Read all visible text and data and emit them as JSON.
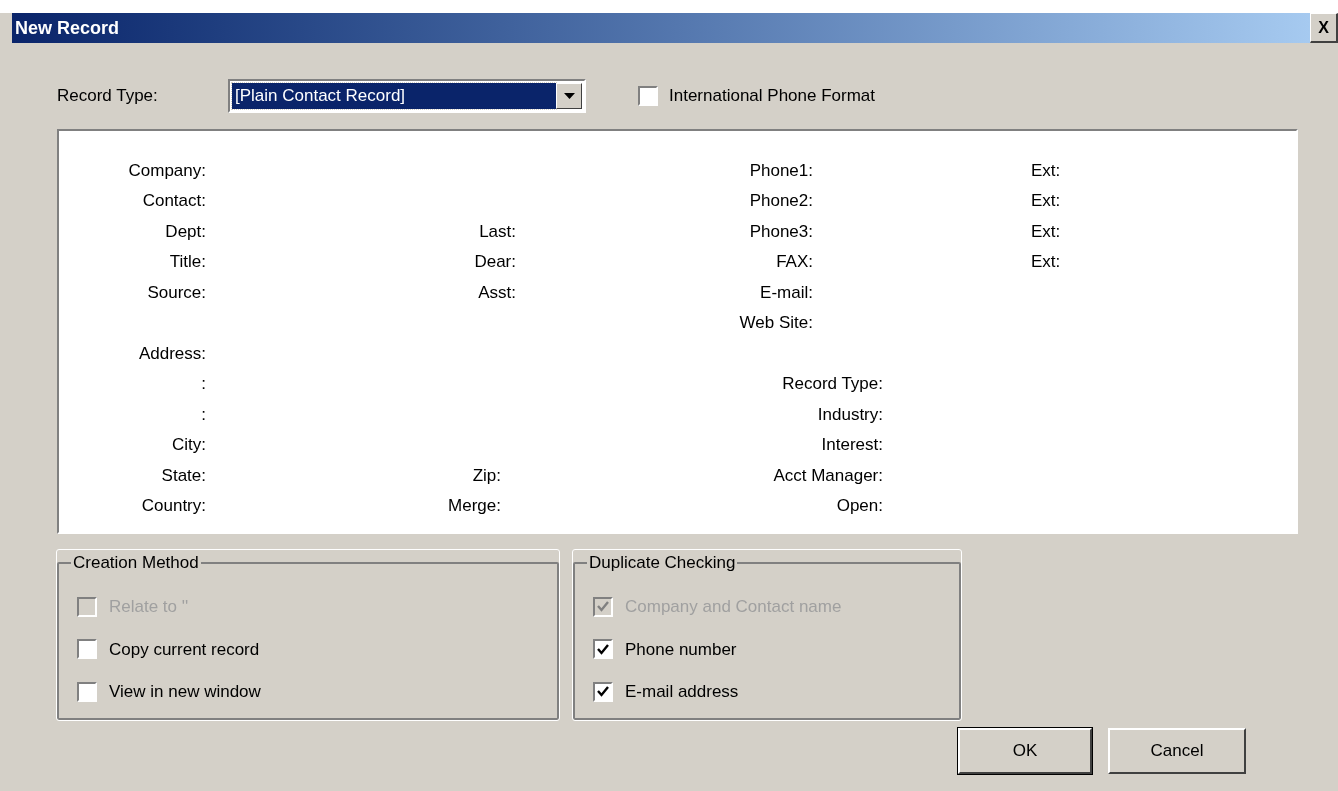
{
  "window": {
    "title": "New Record",
    "close": "X"
  },
  "record_type": {
    "label": "Record Type:",
    "value": "[Plain Contact Record]",
    "focused": true
  },
  "international_phone_format": {
    "label": "International Phone Format",
    "checked": false
  },
  "form_rows": [
    {
      "kind": "upper",
      "left": "Company:",
      "right": "Phone1:",
      "ext": "Ext:"
    },
    {
      "kind": "upper",
      "left": "Contact:",
      "right": "Phone2:",
      "ext": "Ext:"
    },
    {
      "kind": "upper",
      "left": "Dept:",
      "middle": "Last:",
      "right": "Phone3:",
      "ext": "Ext:"
    },
    {
      "kind": "upper",
      "left": "Title:",
      "middle": "Dear:",
      "right": "FAX:",
      "ext": "Ext:"
    },
    {
      "kind": "upper",
      "left": "Source:",
      "middle": "Asst:",
      "right": "E-mail:"
    },
    {
      "kind": "upper",
      "right": "Web Site:"
    },
    {
      "kind": "lower",
      "left": "Address:"
    },
    {
      "kind": "lower",
      "left": ":",
      "right": "Record Type:"
    },
    {
      "kind": "lower",
      "left": ":",
      "right": "Industry:"
    },
    {
      "kind": "lower",
      "left": "City:",
      "right": "Interest:"
    },
    {
      "kind": "lower",
      "left": "State:",
      "middle": "Zip:",
      "right": "Acct Manager:"
    },
    {
      "kind": "lower",
      "left": "Country:",
      "middle": "Merge:",
      "right": "Open:"
    }
  ],
  "groups": [
    {
      "title": "Creation Method",
      "options": [
        {
          "label": "Relate to ''",
          "checked": false,
          "disabled": true
        },
        {
          "label": "Copy current record",
          "checked": false,
          "disabled": false
        },
        {
          "label": "View in new window",
          "checked": false,
          "disabled": false
        }
      ]
    },
    {
      "title": "Duplicate Checking",
      "options": [
        {
          "label": "Company and Contact name",
          "checked": true,
          "disabled": true
        },
        {
          "label": "Phone number",
          "checked": true,
          "disabled": false
        },
        {
          "label": "E-mail address",
          "checked": true,
          "disabled": false
        }
      ]
    }
  ],
  "buttons": [
    {
      "label": "OK",
      "default": true
    },
    {
      "label": "Cancel",
      "default": false
    }
  ]
}
